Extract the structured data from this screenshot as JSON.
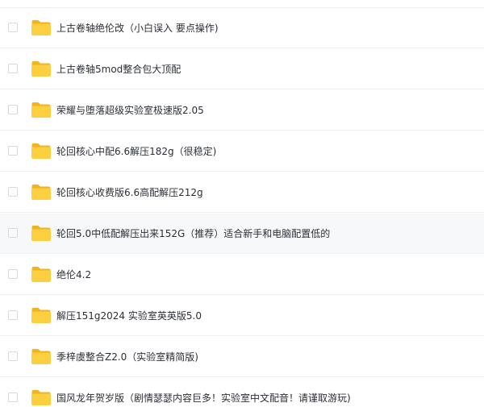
{
  "file_list": {
    "items": [
      {
        "name": "上古卷轴绝伦改（小白误入 要点操作)"
      },
      {
        "name": "上古卷轴5mod整合包大顶配"
      },
      {
        "name": "荣耀与堕落超级实验室极速版2.05"
      },
      {
        "name": "轮回核心中配6.6解压182g（很稳定)"
      },
      {
        "name": "轮回核心收费版6.6高配解压212g"
      },
      {
        "name": "轮回5.0中低配解压出来152G（推荐）适合新手和电脑配置低的"
      },
      {
        "name": "绝伦4.2"
      },
      {
        "name": "解压151g2024 实验室英英版5.0"
      },
      {
        "name": "季梓虞整合Z2.0（实验室精简版)"
      },
      {
        "name": "国风龙年贺岁版（剧情瑟瑟内容巨多！实验室中文配音！请谨取游玩)"
      }
    ],
    "highlighted_row": 5
  },
  "colors": {
    "folder_back": "#f2b31f",
    "folder_front": "#fbcf3f",
    "row_hover_bg": "#f7f8fa",
    "divider": "#eef0f3",
    "text": "#2b2f36"
  },
  "icons": {
    "folder": "folder-icon",
    "checkbox": "checkbox"
  }
}
